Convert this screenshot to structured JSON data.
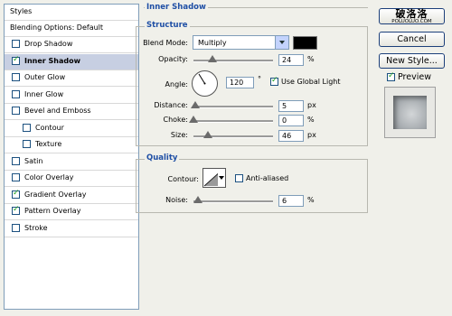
{
  "styles_panel": {
    "header": "Styles",
    "blending_options": "Blending Options: Default",
    "items": [
      {
        "label": "Drop Shadow",
        "checked": false
      },
      {
        "label": "Inner Shadow",
        "checked": true,
        "selected": true
      },
      {
        "label": "Outer Glow",
        "checked": false
      },
      {
        "label": "Inner Glow",
        "checked": false
      },
      {
        "label": "Bevel and Emboss",
        "checked": false
      },
      {
        "label": "Contour",
        "checked": false,
        "sub": true
      },
      {
        "label": "Texture",
        "checked": false,
        "sub": true
      },
      {
        "label": "Satin",
        "checked": false
      },
      {
        "label": "Color Overlay",
        "checked": false
      },
      {
        "label": "Gradient Overlay",
        "checked": true
      },
      {
        "label": "Pattern Overlay",
        "checked": true
      },
      {
        "label": "Stroke",
        "checked": false
      }
    ]
  },
  "inner_shadow": {
    "title": "Inner Shadow",
    "structure": {
      "title": "Structure",
      "blend_mode_label": "Blend Mode:",
      "blend_mode_value": "Multiply",
      "shadow_color": "#000000",
      "opacity": {
        "label": "Opacity:",
        "value": "24",
        "unit": "%",
        "level": 0.24
      },
      "angle": {
        "label": "Angle:",
        "value": "120",
        "unit": "°",
        "global_light_label": "Use Global Light",
        "use_global_light": true
      },
      "distance": {
        "label": "Distance:",
        "value": "5",
        "unit": "px",
        "level": 0.02
      },
      "choke": {
        "label": "Choke:",
        "value": "0",
        "unit": "%",
        "level": 0.0
      },
      "size": {
        "label": "Size:",
        "value": "46",
        "unit": "px",
        "level": 0.18
      }
    },
    "quality": {
      "title": "Quality",
      "contour_label": "Contour:",
      "anti_aliased_label": "Anti-aliased",
      "anti_aliased": false,
      "noise": {
        "label": "Noise:",
        "value": "6",
        "unit": "%",
        "level": 0.06
      }
    }
  },
  "buttons": {
    "ok": "OK",
    "cancel": "Cancel",
    "new_style": "New Style...",
    "preview": "Preview"
  },
  "watermark": {
    "main": "破洛洛",
    "sub": "POLUOLUO.COM"
  }
}
